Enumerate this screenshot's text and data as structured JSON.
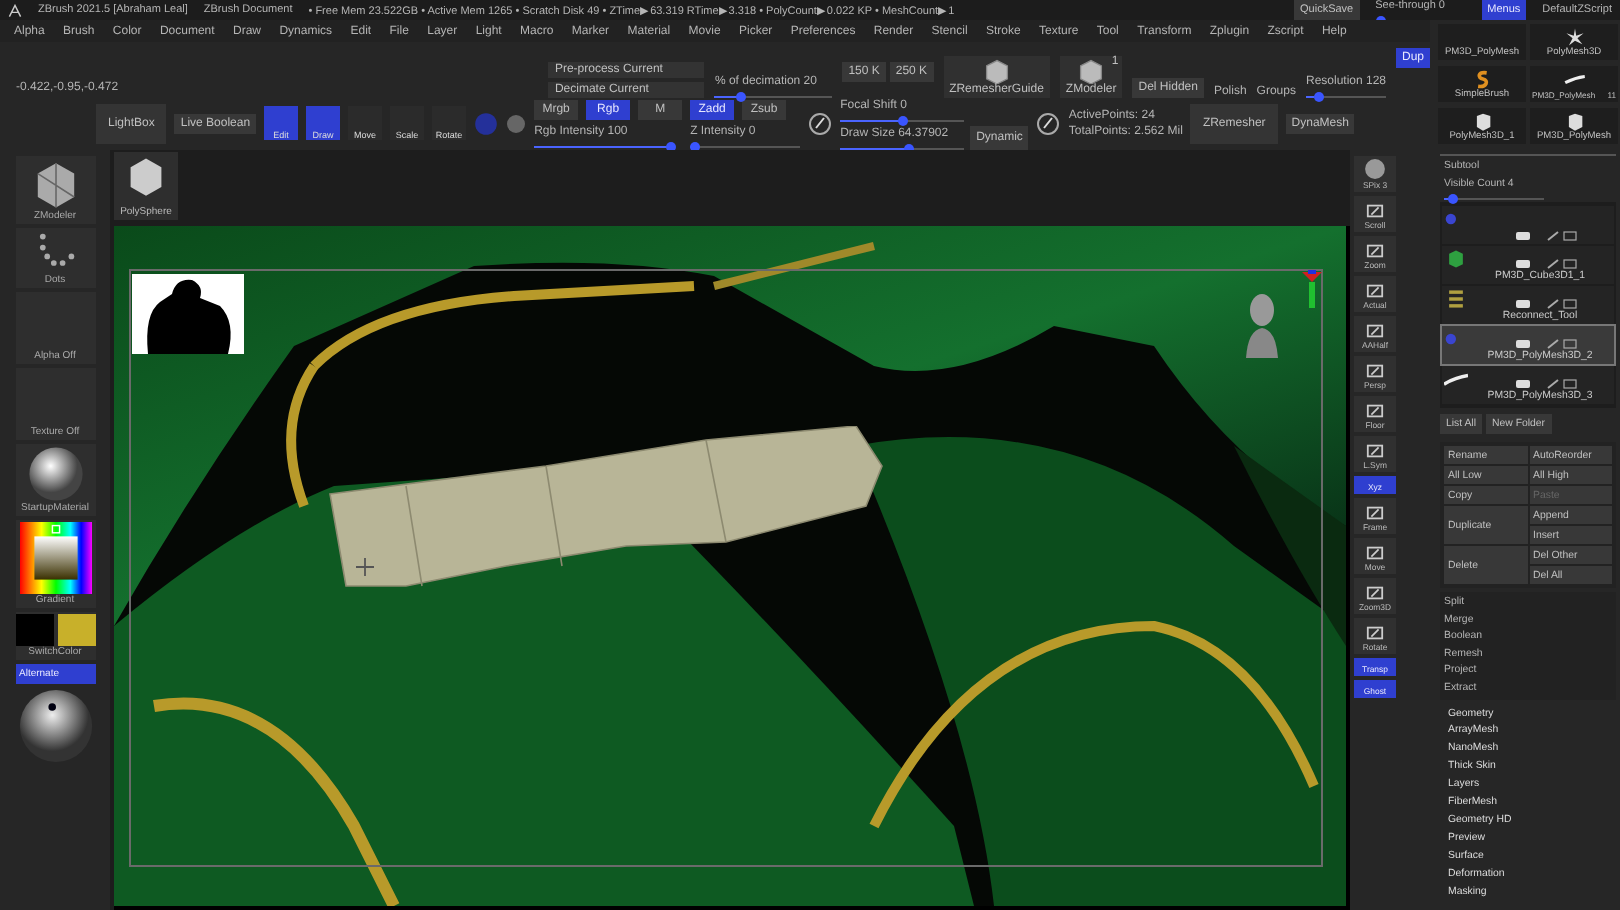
{
  "title_bar": {
    "app": "ZBrush 2021.5 [Abraham Leal]",
    "document": "ZBrush Document",
    "stats": "• Free Mem 23.522GB • Active Mem 1265 • Scratch Disk 49 • ZTime▶63.319 RTime▶3.318 • PolyCount▶0.022 KP • MeshCount▶1",
    "quicksave": "QuickSave",
    "see_through": {
      "label": "See-through 0",
      "level": 0
    },
    "menus_button": {
      "label": "Menus",
      "on": true
    },
    "script": "DefaultZScript"
  },
  "menu_bar": [
    "Alpha",
    "Brush",
    "Color",
    "Document",
    "Draw",
    "Dynamics",
    "Edit",
    "File",
    "Layer",
    "Light",
    "Macro",
    "Marker",
    "Material",
    "Movie",
    "Picker",
    "Preferences",
    "Render",
    "Stencil",
    "Stroke",
    "Texture",
    "Tool",
    "Transform",
    "Zplugin",
    "Zscript",
    "Help"
  ],
  "shelf": {
    "coordinates": "-0.422,-0.95,-0.472",
    "decimation_buttons": [
      "Pre-process Current",
      "Decimate Current"
    ],
    "decimation_slider": {
      "label": "% of decimation 20",
      "level": 0.2
    },
    "poly_targets": [
      "150 K",
      "250 K"
    ],
    "plugins": [
      {
        "label": "ZRemesherGuide"
      },
      {
        "label": "ZModeler",
        "badge": "1"
      }
    ],
    "del_hidden": "Del Hidden",
    "polish": "Polish",
    "groups": "Groups",
    "resolution": {
      "label": "Resolution 128",
      "level": 0.1
    },
    "dup": {
      "label": "Dup",
      "on": true
    },
    "lightbox": "LightBox",
    "live_boolean": "Live Boolean",
    "modes": [
      {
        "label": "Edit",
        "on": true
      },
      {
        "label": "Draw",
        "on": true
      },
      {
        "label": "Move",
        "on": false
      },
      {
        "label": "Scale",
        "on": false
      },
      {
        "label": "Rotate",
        "on": false
      }
    ],
    "channels": [
      {
        "label": "Mrgb",
        "on": false
      },
      {
        "label": "Rgb",
        "on": true
      },
      {
        "label": "M",
        "on": false
      },
      {
        "label": "Zadd",
        "on": true
      },
      {
        "label": "Zsub",
        "on": false
      }
    ],
    "rgb_intensity": {
      "label": "Rgb Intensity 100",
      "level": 1
    },
    "z_intensity": {
      "label": "Z Intensity 0",
      "level": 0
    },
    "focal_shift": {
      "label": "Focal Shift 0",
      "level": 0.5
    },
    "draw_size": {
      "label": "Draw Size 64.37902",
      "level": 0.55
    },
    "dynamic": "Dynamic",
    "active_points": "ActivePoints: 24",
    "total_points": "TotalPoints: 2.562 Mil",
    "zremesher": "ZRemesher",
    "dynamesh": "DynaMesh"
  },
  "tool_palette": [
    {
      "name": "PM3D_PolyMesh",
      "kind": "blank"
    },
    {
      "name": "PolyMesh3D",
      "kind": "star"
    },
    {
      "name": "SimpleBrush",
      "kind": "s"
    },
    {
      "name": "PM3D_PolyMesh",
      "kind": "stroke",
      "badge": "11"
    },
    {
      "name": "PolyMesh3D_1",
      "kind": "cube"
    },
    {
      "name": "PM3D_PolyMesh",
      "kind": "cube"
    }
  ],
  "left_bar": {
    "items": [
      {
        "kind": "tool",
        "label": "ZModeler"
      },
      {
        "kind": "dots",
        "label": "Dots"
      },
      {
        "kind": "blank",
        "label": "Alpha Off"
      },
      {
        "kind": "blank",
        "label": "Texture Off"
      },
      {
        "kind": "material",
        "label": "StartupMaterial"
      },
      {
        "kind": "picker",
        "label": "Gradient"
      },
      {
        "kind": "swatches",
        "label": "SwitchColor"
      }
    ],
    "alternate": {
      "label": "Alternate",
      "on": true
    }
  },
  "viewport": {
    "subtool_thumb": "PolySphere"
  },
  "right_shelf": [
    {
      "label": "SPix 3",
      "kind": "sphere",
      "on": false
    },
    {
      "label": "Scroll",
      "kind": "icon",
      "on": false
    },
    {
      "label": "Zoom",
      "kind": "icon",
      "on": false
    },
    {
      "label": "Actual",
      "kind": "icon",
      "on": false
    },
    {
      "label": "AAHalf",
      "kind": "icon",
      "on": false
    },
    {
      "label": "Persp",
      "kind": "icon",
      "on": false
    },
    {
      "label": "Floor",
      "kind": "icon",
      "on": false
    },
    {
      "label": "L.Sym",
      "kind": "icon",
      "on": false
    },
    {
      "label": "Xyz",
      "kind": "flat",
      "on": true
    },
    {
      "label": "Frame",
      "kind": "icon",
      "on": false
    },
    {
      "label": "Move",
      "kind": "icon",
      "on": false
    },
    {
      "label": "Zoom3D",
      "kind": "icon",
      "on": false
    },
    {
      "label": "Rotate",
      "kind": "icon",
      "on": false
    },
    {
      "label": "Transp",
      "kind": "flat",
      "on": true
    },
    {
      "label": "Ghost",
      "kind": "flat",
      "on": true
    }
  ],
  "tray": {
    "title": "Subtool",
    "visible_count": {
      "label": "Visible Count 4",
      "level": 0.05
    },
    "items": [
      {
        "kind": "partial",
        "selected": false
      },
      {
        "name": "PM3D_Cube3D1_1",
        "kind": "cube",
        "selected": false
      },
      {
        "name": "Reconnect_Tool",
        "kind": "stack",
        "selected": false
      },
      {
        "name": "PM3D_PolyMesh3D_2",
        "kind": "plain",
        "selected": true
      },
      {
        "name": "PM3D_PolyMesh3D_3",
        "kind": "stroke",
        "selected": false
      }
    ],
    "list_all": "List All",
    "new_folder": "New Folder",
    "actions": [
      {
        "label": "Rename",
        "kind": "normal",
        "disabled": false
      },
      {
        "label": "AutoReorder",
        "kind": "normal",
        "disabled": false
      },
      {
        "label": "All Low",
        "kind": "normal",
        "disabled": false
      },
      {
        "label": "All High",
        "kind": "normal",
        "disabled": false
      },
      {
        "label": "Copy",
        "kind": "normal",
        "disabled": false
      },
      {
        "label": "Paste",
        "kind": "normal",
        "disabled": true
      },
      {
        "label": "Append",
        "kind": "normal",
        "disabled": false
      },
      {
        "label": "Duplicate",
        "kind": "tall",
        "disabled": false
      },
      {
        "label": "Insert",
        "kind": "normal",
        "disabled": false
      },
      {
        "label": "Del Other",
        "kind": "normal",
        "disabled": false
      },
      {
        "label": "Delete",
        "kind": "tall",
        "disabled": false
      },
      {
        "label": "Del All",
        "kind": "normal",
        "disabled": false
      }
    ],
    "more": [
      "Split",
      "Merge",
      "Boolean",
      "Remesh",
      "Project",
      "Extract"
    ],
    "sections": [
      "Geometry",
      "ArrayMesh",
      "NanoMesh",
      "Thick Skin",
      "Layers",
      "FiberMesh",
      "Geometry HD",
      "Preview",
      "Surface",
      "Deformation",
      "Masking"
    ]
  }
}
